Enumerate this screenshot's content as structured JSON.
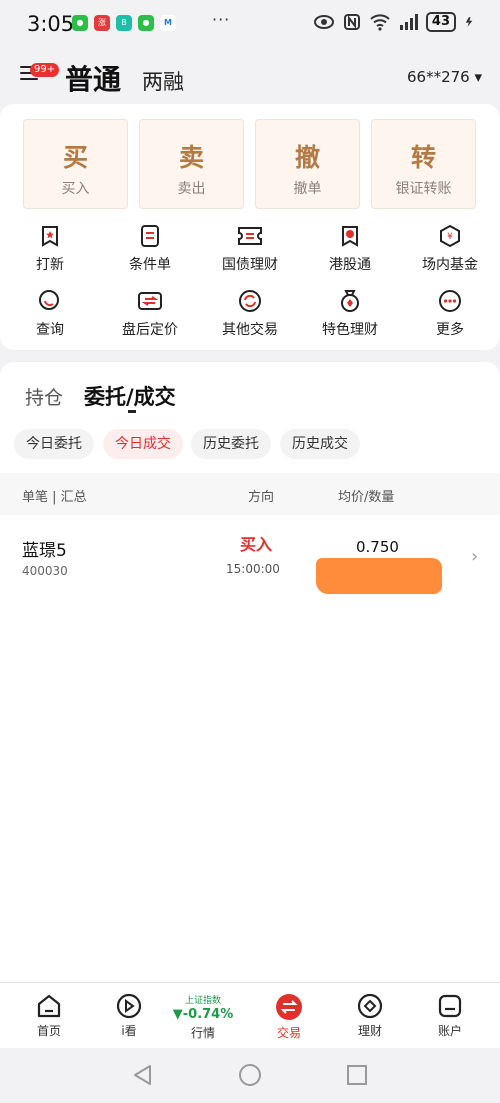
{
  "status_bar": {
    "time": "3:05",
    "dots": "···",
    "battery": "43"
  },
  "header": {
    "badge": "99+",
    "tab_normal": "普通",
    "tab_margin": "两融",
    "account": "66**276 ▾"
  },
  "actions": [
    {
      "title": "买",
      "sub": "买入"
    },
    {
      "title": "卖",
      "sub": "卖出"
    },
    {
      "title": "撤",
      "sub": "撤单"
    },
    {
      "title": "转",
      "sub": "银证转账"
    }
  ],
  "grid": [
    {
      "label": "打新",
      "icon": "ipo-icon"
    },
    {
      "label": "条件单",
      "icon": "condition-order-icon"
    },
    {
      "label": "国债理财",
      "icon": "bond-icon"
    },
    {
      "label": "港股通",
      "icon": "hk-stock-icon"
    },
    {
      "label": "场内基金",
      "icon": "fund-icon"
    },
    {
      "label": "查询",
      "icon": "query-icon"
    },
    {
      "label": "盘后定价",
      "icon": "after-hours-icon"
    },
    {
      "label": "其他交易",
      "icon": "other-trade-icon"
    },
    {
      "label": "特色理财",
      "icon": "featured-finance-icon"
    },
    {
      "label": "更多",
      "icon": "more-icon"
    }
  ],
  "positions": {
    "tab_holdings": "持仓",
    "tab_orders": "委托/成交",
    "chips": [
      "今日委托",
      "今日成交",
      "历史委托",
      "历史成交"
    ],
    "active_chip": "今日成交",
    "headers": {
      "col1": "单笔 | 汇总",
      "col2": "方向",
      "col3": "均价/数量"
    },
    "rows": [
      {
        "name": "蓝璟5",
        "code": "400030",
        "direction": "买入",
        "time": "15:00:00",
        "price": "0.750"
      }
    ]
  },
  "bottom_nav": [
    {
      "label": "首页",
      "icon": "home-icon"
    },
    {
      "label": "i看",
      "icon": "watch-icon"
    },
    {
      "label": "行情",
      "index_name": "上证指数",
      "index_value": "▼-0.74%"
    },
    {
      "label": "交易",
      "icon": "trade-icon"
    },
    {
      "label": "理财",
      "icon": "finance-icon"
    },
    {
      "label": "账户",
      "icon": "account-icon"
    }
  ],
  "colors": {
    "accent_red": "#e0302a",
    "gold": "#b37a44",
    "green": "#1b9a4a",
    "redaction": "#ff8c3a"
  }
}
